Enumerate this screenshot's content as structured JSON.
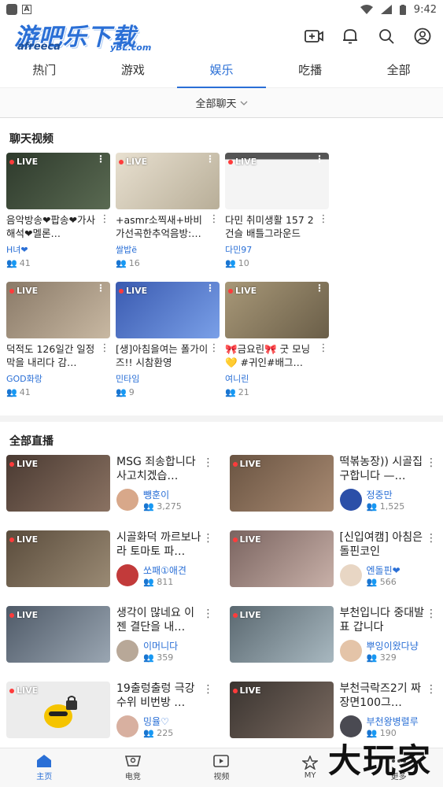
{
  "status": {
    "time": "9:42"
  },
  "header": {
    "logo": "游吧乐下载",
    "logo_sub": "yBL.com",
    "logo_small": "afreeca"
  },
  "tabs": [
    {
      "label": "热门"
    },
    {
      "label": "游戏"
    },
    {
      "label": "娱乐"
    },
    {
      "label": "吃播"
    },
    {
      "label": "全部"
    }
  ],
  "filter": {
    "label": "全部聊天"
  },
  "chat_section": {
    "title": "聊天视频",
    "live_label": "LIVE"
  },
  "chat_cards": [
    {
      "title": "음악방송❤팝송❤가사해석❤멜론…",
      "streamer": "H녀❤",
      "viewers": "41",
      "color": "#3f4a3c"
    },
    {
      "title": "+asmr소찍새+바비가선곡한추억음방:…",
      "streamer": "쌀밥ë",
      "viewers": "16",
      "color": "#c9c2b4"
    },
    {
      "title": "다민 취미생활 157 2건슬 배틀그라운드",
      "streamer": "다민97",
      "viewers": "10",
      "color": "#d9d9d9"
    },
    {
      "title": "덕적도 126일간 일정 막을 내리다 감…",
      "streamer": "GOD화랑",
      "viewers": "41",
      "color": "#7a6a5a"
    },
    {
      "title": "[생]아침을여는 폴가이즈!! 시참환영",
      "streamer": "민타임",
      "viewers": "9",
      "color": "#4a6fc1"
    },
    {
      "title": "🎀금요린🎀 굿 모닝 💛 #귀인#배그…",
      "streamer": "여니린",
      "viewers": "21",
      "color": "#8a7a5a"
    }
  ],
  "live_section": {
    "title": "全部直播"
  },
  "live_items": [
    {
      "title": "MSG 죄송합니다 사고치겠습…",
      "streamer": "뺑훈이",
      "viewers": "3,275",
      "color": "#5a4a42",
      "avatar": "#d8a88a"
    },
    {
      "title": "떡볶농장)) 시골집 구합니다 —…",
      "streamer": "정중만",
      "viewers": "1,525",
      "color": "#7a6452",
      "avatar": "#2b4fa8"
    },
    {
      "title": "시골화덕 까르보나라 토마토 파…",
      "streamer": "쏘패①애견",
      "viewers": "811",
      "color": "#6a5c4c",
      "avatar": "#c23a3a"
    },
    {
      "title": "[신입여캠] 아침은 돌핀코인",
      "streamer": "엔돌핀❤",
      "viewers": "566",
      "color": "#8a7470",
      "avatar": "#e8d6c4"
    },
    {
      "title": "생각이 많네요 이젠 결단을 내…",
      "streamer": "이머니다",
      "viewers": "359",
      "color": "#5f6a78",
      "avatar": "#b8a898"
    },
    {
      "title": "부천입니다 중대발표 갑니다",
      "streamer": "뿌잉이왔다냥",
      "viewers": "329",
      "color": "#6a7880",
      "avatar": "#e4c4a8"
    },
    {
      "title": "19출렁출렁 극강수위 비번방 …",
      "streamer": "밍율♡",
      "viewers": "225",
      "color": "#e8e8e8",
      "avatar": "#d8b0a0"
    },
    {
      "title": "부천극락즈2기 짜장면100그…",
      "streamer": "부천왕병렬루",
      "viewers": "190",
      "color": "#4a4440",
      "avatar": "#4a4a52"
    }
  ],
  "nav": [
    {
      "label": "主页"
    },
    {
      "label": "电竞"
    },
    {
      "label": "视频"
    },
    {
      "label": "MY"
    },
    {
      "label": "更多"
    }
  ],
  "watermark": "大玩家"
}
